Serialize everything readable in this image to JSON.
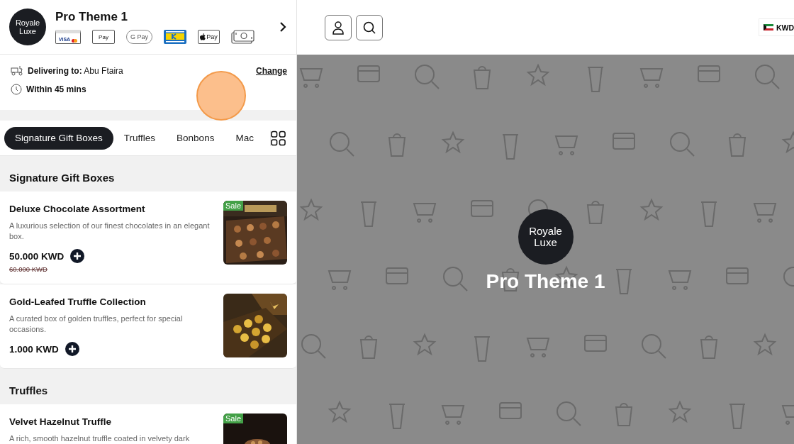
{
  "store": {
    "logo": [
      "Royale",
      "Luxe"
    ],
    "title": "Pro Theme 1"
  },
  "payment_methods": [
    {
      "kind": "card",
      "label": "VISA"
    },
    {
      "kind": "samsung",
      "label": "Pay"
    },
    {
      "kind": "gpay",
      "label": "G Pay"
    },
    {
      "kind": "knet"
    },
    {
      "kind": "applepay",
      "label": "Pay"
    },
    {
      "kind": "cash"
    }
  ],
  "delivery": {
    "label": "Delivering to:",
    "area": "Abu Ftaira",
    "action": "Change",
    "time": "Within 45 mins"
  },
  "tabs": [
    {
      "label": "Signature Gift Boxes",
      "selected": true
    },
    {
      "label": "Truffles",
      "selected": false
    },
    {
      "label": "Bonbons",
      "selected": false
    },
    {
      "label": "Mac",
      "selected": false
    }
  ],
  "sections": [
    {
      "title": "Signature Gift Boxes",
      "products": [
        {
          "name": "Deluxe Chocolate Assortment",
          "description": "A luxurious selection of our finest chocolates in an elegant box.",
          "price": "50.000 KWD",
          "old_price": "60.000 KWD",
          "badge": "Sale"
        },
        {
          "name": "Gold-Leafed Truffle Collection",
          "description": "A curated box of golden truffles, perfect for special occasions.",
          "price": "1.000 KWD"
        }
      ]
    },
    {
      "title": "Truffles",
      "products": [
        {
          "name": "Velvet Hazelnut Truffle",
          "description": "A rich, smooth hazelnut truffle coated in velvety dark",
          "badge": "Sale"
        }
      ]
    }
  ],
  "currency": "KWD",
  "hero": {
    "logo": [
      "Royale",
      "Luxe"
    ],
    "title": "Pro Theme 1"
  }
}
